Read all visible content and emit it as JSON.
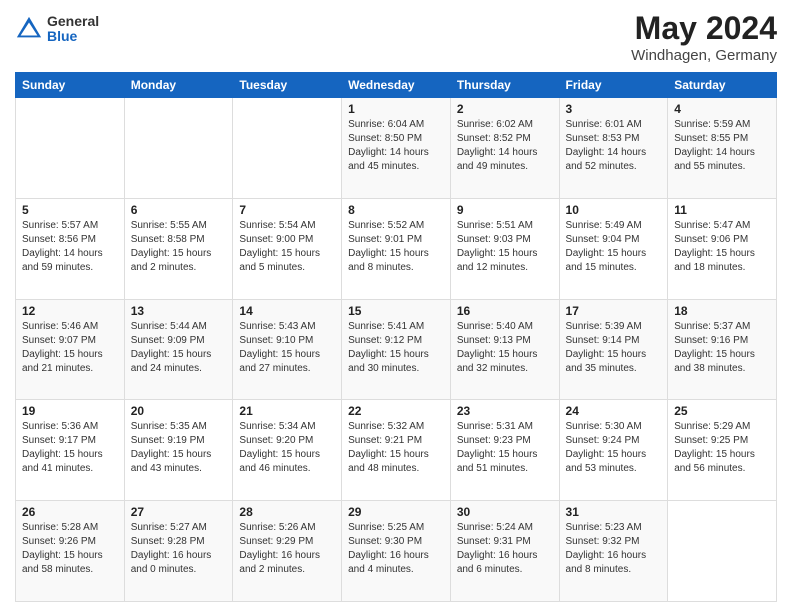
{
  "logo": {
    "general": "General",
    "blue": "Blue"
  },
  "header": {
    "title": "May 2024",
    "subtitle": "Windhagen, Germany"
  },
  "weekdays": [
    "Sunday",
    "Monday",
    "Tuesday",
    "Wednesday",
    "Thursday",
    "Friday",
    "Saturday"
  ],
  "weeks": [
    [
      {
        "day": "",
        "info": ""
      },
      {
        "day": "",
        "info": ""
      },
      {
        "day": "",
        "info": ""
      },
      {
        "day": "1",
        "info": "Sunrise: 6:04 AM\nSunset: 8:50 PM\nDaylight: 14 hours\nand 45 minutes."
      },
      {
        "day": "2",
        "info": "Sunrise: 6:02 AM\nSunset: 8:52 PM\nDaylight: 14 hours\nand 49 minutes."
      },
      {
        "day": "3",
        "info": "Sunrise: 6:01 AM\nSunset: 8:53 PM\nDaylight: 14 hours\nand 52 minutes."
      },
      {
        "day": "4",
        "info": "Sunrise: 5:59 AM\nSunset: 8:55 PM\nDaylight: 14 hours\nand 55 minutes."
      }
    ],
    [
      {
        "day": "5",
        "info": "Sunrise: 5:57 AM\nSunset: 8:56 PM\nDaylight: 14 hours\nand 59 minutes."
      },
      {
        "day": "6",
        "info": "Sunrise: 5:55 AM\nSunset: 8:58 PM\nDaylight: 15 hours\nand 2 minutes."
      },
      {
        "day": "7",
        "info": "Sunrise: 5:54 AM\nSunset: 9:00 PM\nDaylight: 15 hours\nand 5 minutes."
      },
      {
        "day": "8",
        "info": "Sunrise: 5:52 AM\nSunset: 9:01 PM\nDaylight: 15 hours\nand 8 minutes."
      },
      {
        "day": "9",
        "info": "Sunrise: 5:51 AM\nSunset: 9:03 PM\nDaylight: 15 hours\nand 12 minutes."
      },
      {
        "day": "10",
        "info": "Sunrise: 5:49 AM\nSunset: 9:04 PM\nDaylight: 15 hours\nand 15 minutes."
      },
      {
        "day": "11",
        "info": "Sunrise: 5:47 AM\nSunset: 9:06 PM\nDaylight: 15 hours\nand 18 minutes."
      }
    ],
    [
      {
        "day": "12",
        "info": "Sunrise: 5:46 AM\nSunset: 9:07 PM\nDaylight: 15 hours\nand 21 minutes."
      },
      {
        "day": "13",
        "info": "Sunrise: 5:44 AM\nSunset: 9:09 PM\nDaylight: 15 hours\nand 24 minutes."
      },
      {
        "day": "14",
        "info": "Sunrise: 5:43 AM\nSunset: 9:10 PM\nDaylight: 15 hours\nand 27 minutes."
      },
      {
        "day": "15",
        "info": "Sunrise: 5:41 AM\nSunset: 9:12 PM\nDaylight: 15 hours\nand 30 minutes."
      },
      {
        "day": "16",
        "info": "Sunrise: 5:40 AM\nSunset: 9:13 PM\nDaylight: 15 hours\nand 32 minutes."
      },
      {
        "day": "17",
        "info": "Sunrise: 5:39 AM\nSunset: 9:14 PM\nDaylight: 15 hours\nand 35 minutes."
      },
      {
        "day": "18",
        "info": "Sunrise: 5:37 AM\nSunset: 9:16 PM\nDaylight: 15 hours\nand 38 minutes."
      }
    ],
    [
      {
        "day": "19",
        "info": "Sunrise: 5:36 AM\nSunset: 9:17 PM\nDaylight: 15 hours\nand 41 minutes."
      },
      {
        "day": "20",
        "info": "Sunrise: 5:35 AM\nSunset: 9:19 PM\nDaylight: 15 hours\nand 43 minutes."
      },
      {
        "day": "21",
        "info": "Sunrise: 5:34 AM\nSunset: 9:20 PM\nDaylight: 15 hours\nand 46 minutes."
      },
      {
        "day": "22",
        "info": "Sunrise: 5:32 AM\nSunset: 9:21 PM\nDaylight: 15 hours\nand 48 minutes."
      },
      {
        "day": "23",
        "info": "Sunrise: 5:31 AM\nSunset: 9:23 PM\nDaylight: 15 hours\nand 51 minutes."
      },
      {
        "day": "24",
        "info": "Sunrise: 5:30 AM\nSunset: 9:24 PM\nDaylight: 15 hours\nand 53 minutes."
      },
      {
        "day": "25",
        "info": "Sunrise: 5:29 AM\nSunset: 9:25 PM\nDaylight: 15 hours\nand 56 minutes."
      }
    ],
    [
      {
        "day": "26",
        "info": "Sunrise: 5:28 AM\nSunset: 9:26 PM\nDaylight: 15 hours\nand 58 minutes."
      },
      {
        "day": "27",
        "info": "Sunrise: 5:27 AM\nSunset: 9:28 PM\nDaylight: 16 hours\nand 0 minutes."
      },
      {
        "day": "28",
        "info": "Sunrise: 5:26 AM\nSunset: 9:29 PM\nDaylight: 16 hours\nand 2 minutes."
      },
      {
        "day": "29",
        "info": "Sunrise: 5:25 AM\nSunset: 9:30 PM\nDaylight: 16 hours\nand 4 minutes."
      },
      {
        "day": "30",
        "info": "Sunrise: 5:24 AM\nSunset: 9:31 PM\nDaylight: 16 hours\nand 6 minutes."
      },
      {
        "day": "31",
        "info": "Sunrise: 5:23 AM\nSunset: 9:32 PM\nDaylight: 16 hours\nand 8 minutes."
      },
      {
        "day": "",
        "info": ""
      }
    ]
  ]
}
